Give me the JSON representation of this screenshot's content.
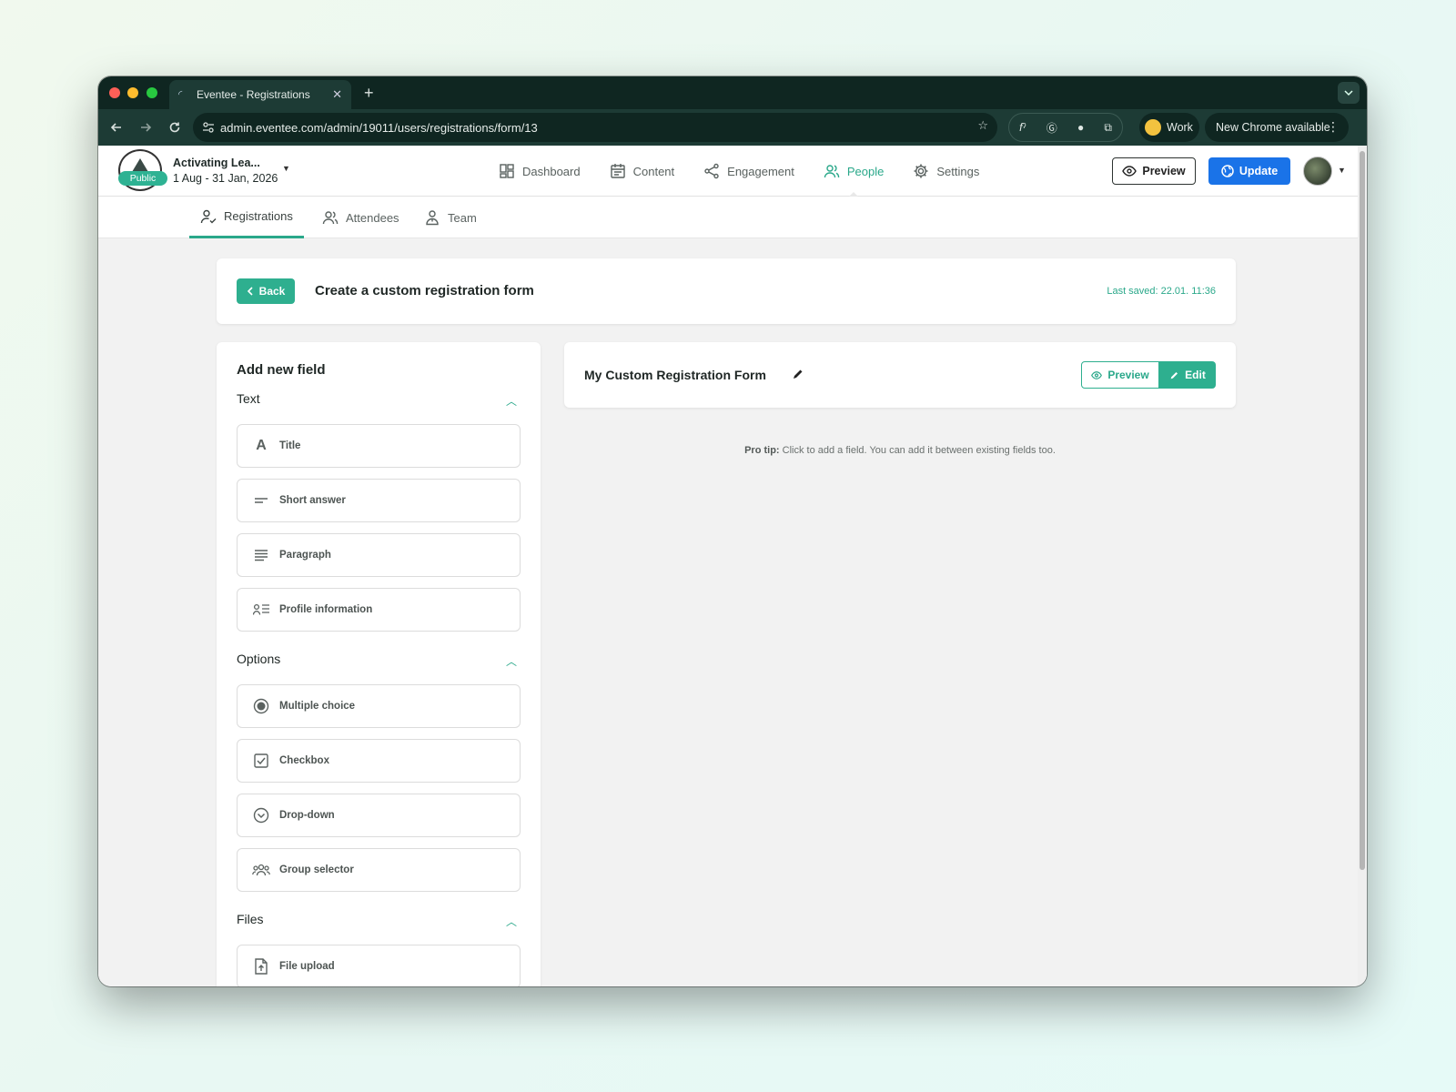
{
  "browser": {
    "tab_title": "Eventee - Registrations",
    "url": "admin.eventee.com/admin/19011/users/registrations/form/13",
    "profile_label": "Work",
    "update_label": "New Chrome available"
  },
  "event": {
    "name": "Activating Lea...",
    "dates": "1 Aug - 31 Jan, 2026",
    "badge": "Public"
  },
  "main_nav": {
    "dashboard": "Dashboard",
    "content": "Content",
    "engagement": "Engagement",
    "people": "People",
    "settings": "Settings",
    "preview": "Preview",
    "update": "Update"
  },
  "sub_nav": {
    "registrations": "Registrations",
    "attendees": "Attendees",
    "team": "Team"
  },
  "header": {
    "back": "Back",
    "title": "Create a custom registration form",
    "last_saved": "Last saved: 22.01. 11:36"
  },
  "sidebar": {
    "heading": "Add new field",
    "sections": {
      "text": "Text",
      "options": "Options",
      "files": "Files"
    },
    "fields": {
      "title": "Title",
      "short_answer": "Short answer",
      "paragraph": "Paragraph",
      "profile_information": "Profile information",
      "multiple_choice": "Multiple choice",
      "checkbox": "Checkbox",
      "dropdown": "Drop-down",
      "group_selector": "Group selector",
      "file_upload": "File upload"
    }
  },
  "form": {
    "name": "My Custom Registration Form",
    "preview": "Preview",
    "edit": "Edit",
    "pro_tip_label": "Pro tip:",
    "pro_tip_text": "Click to add a field. You can add it between existing fields too."
  },
  "colors": {
    "accent": "#2eaf8f",
    "primary_blue": "#1a73e8",
    "chrome_dark": "#0f2621"
  }
}
